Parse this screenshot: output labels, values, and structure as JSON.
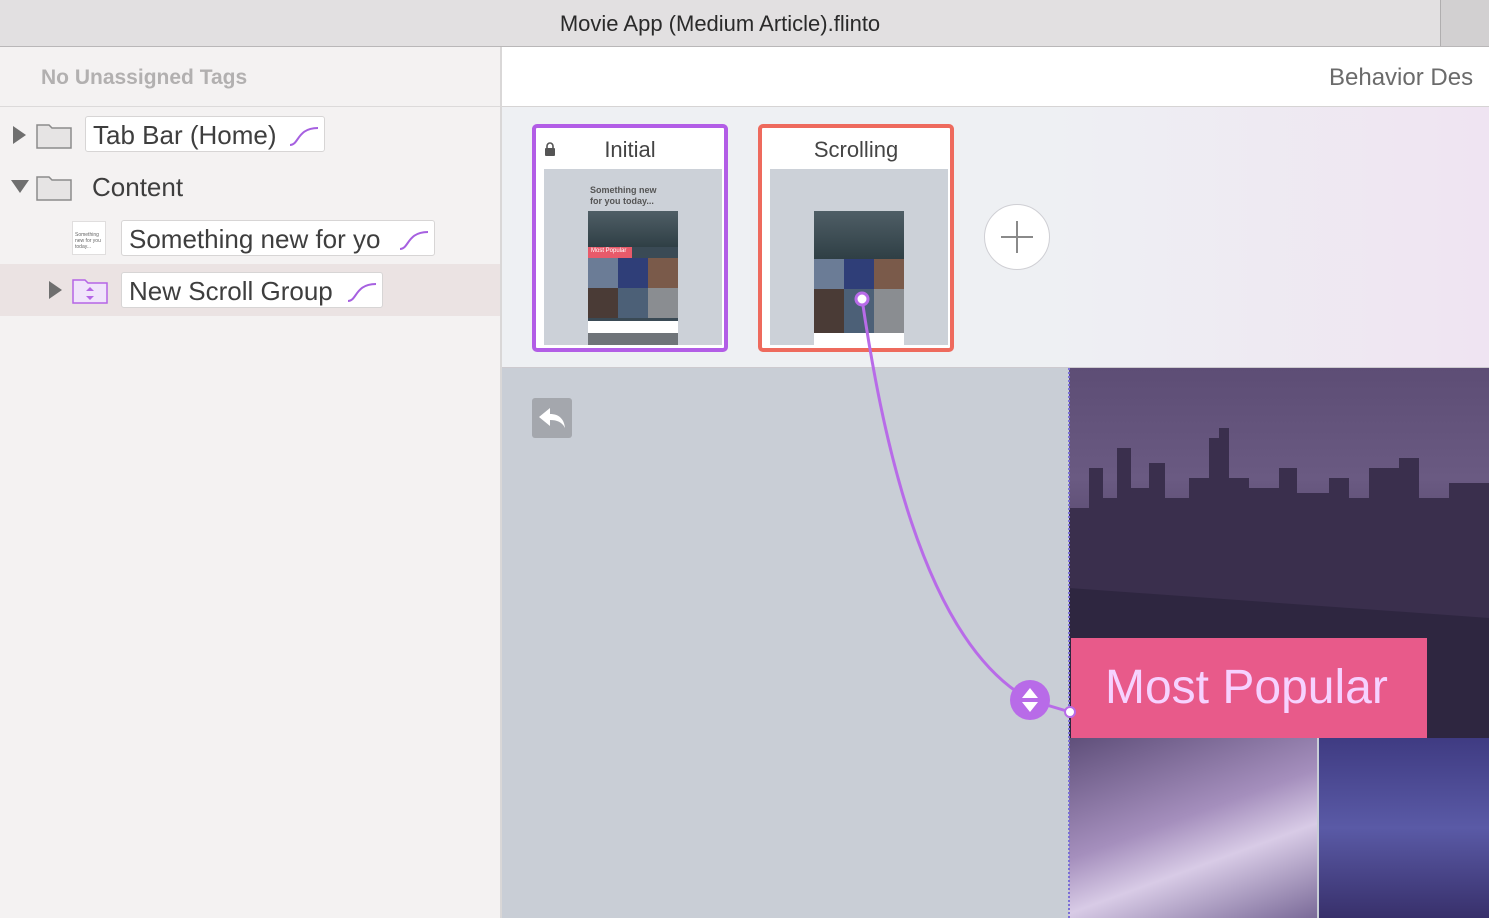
{
  "window": {
    "title": "Movie App (Medium Article).flinto"
  },
  "sidebar": {
    "tags_header": "No Unassigned Tags",
    "layers": [
      {
        "label": "Tab Bar (Home)",
        "expanded": false,
        "icon": "folder-icon"
      },
      {
        "label": "Content",
        "expanded": true,
        "icon": "folder-icon"
      },
      {
        "label": "Something new for yo",
        "icon": "layer-thumbnail",
        "thumb_text": "Something new for you today..."
      },
      {
        "label": "New Scroll Group",
        "expanded": false,
        "icon": "scroll-group-icon",
        "selected": true
      }
    ]
  },
  "toolbar": {
    "behavior_label": "Behavior Des"
  },
  "states": [
    {
      "name": "Initial",
      "locked": true,
      "border_color": "#b25de6",
      "preview_heading": "Something new for you today...",
      "preview_badge": "Most Popular"
    },
    {
      "name": "Scrolling",
      "locked": false,
      "border_color": "#ee6a5d"
    }
  ],
  "canvas": {
    "banner_label": "Most Popular",
    "accent_color": "#b86be8"
  }
}
